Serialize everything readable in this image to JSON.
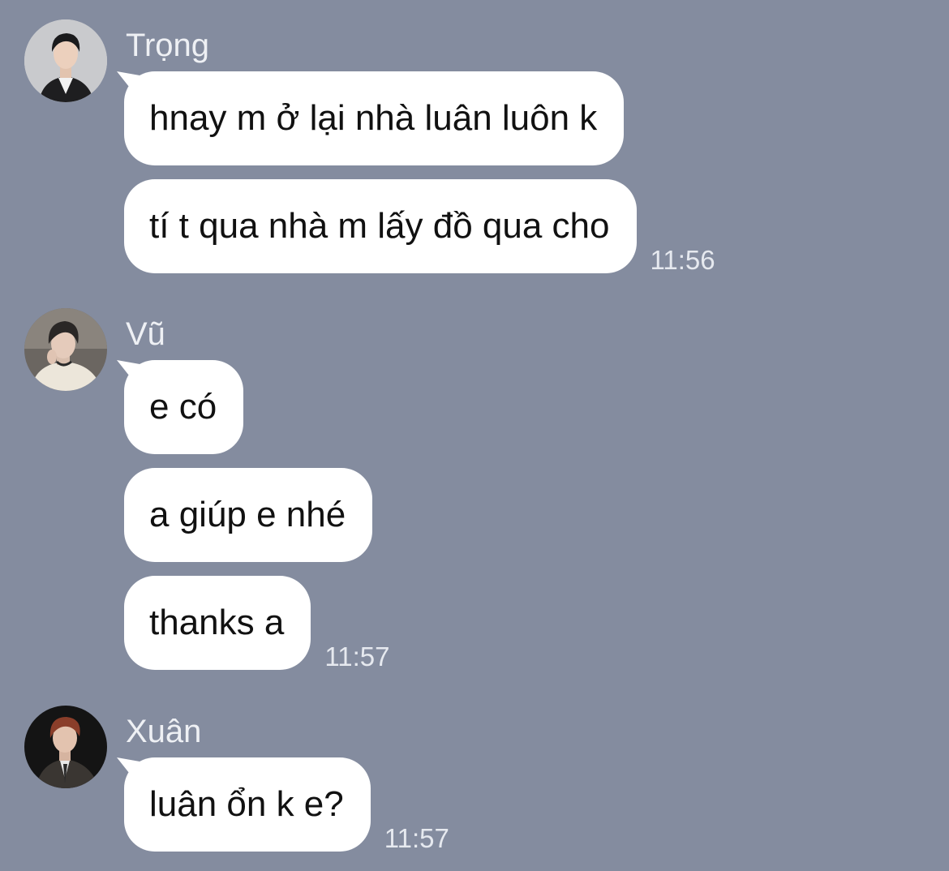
{
  "groups": [
    {
      "sender": "Trọng",
      "avatar_icon": "avatar-trong",
      "messages": [
        {
          "text": "hnay m ở lại nhà luân luôn k",
          "time": ""
        },
        {
          "text": "tí t qua nhà m lấy đồ qua cho",
          "time": "11:56"
        }
      ]
    },
    {
      "sender": "Vũ",
      "avatar_icon": "avatar-vu",
      "messages": [
        {
          "text": "e có",
          "time": ""
        },
        {
          "text": "a giúp e nhé",
          "time": ""
        },
        {
          "text": "thanks a",
          "time": "11:57"
        }
      ]
    },
    {
      "sender": "Xuân",
      "avatar_icon": "avatar-xuan",
      "messages": [
        {
          "text": "luân ổn k e?",
          "time": "11:57"
        }
      ]
    }
  ],
  "colors": {
    "background": "#848c9f",
    "bubble": "#ffffff",
    "text": "#111111",
    "meta_text": "#e6e9ef"
  }
}
